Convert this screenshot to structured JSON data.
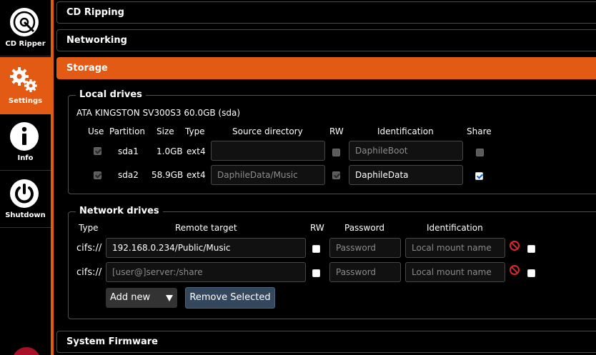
{
  "sidebar": {
    "items": [
      {
        "label": "CD Ripper",
        "icon": "cd-icon"
      },
      {
        "label": "Settings",
        "icon": "gears-icon"
      },
      {
        "label": "Info",
        "icon": "info-icon"
      },
      {
        "label": "Shutdown",
        "icon": "power-icon"
      }
    ]
  },
  "sections": {
    "cd_ripping": "CD Ripping",
    "networking": "Networking",
    "storage": "Storage",
    "system_firmware": "System Firmware"
  },
  "local_drives": {
    "legend": "Local drives",
    "drive_name": "ATA KINGSTON SV300S3 60.0GB (sda)",
    "headers": {
      "use": "Use",
      "partition": "Partition",
      "size": "Size",
      "type": "Type",
      "source": "Source directory",
      "rw": "RW",
      "identification": "Identification",
      "share": "Share"
    },
    "rows": [
      {
        "partition": "sda1",
        "size": "1.0GB",
        "type": "ext4",
        "source": "",
        "identification": "DaphileBoot"
      },
      {
        "partition": "sda2",
        "size": "58.9GB",
        "type": "ext4",
        "source": "DaphileData/Music",
        "identification": "DaphileData"
      }
    ]
  },
  "network_drives": {
    "legend": "Network drives",
    "headers": {
      "type": "Type",
      "remote": "Remote target",
      "rw": "RW",
      "password": "Password",
      "identification": "Identification"
    },
    "rows": [
      {
        "type": "cifs://",
        "remote": "192.168.0.234/Public/Music",
        "password_placeholder": "Password",
        "identification_placeholder": "Local mount name"
      },
      {
        "type": "cifs://",
        "remote_placeholder": "[user@]server:/share",
        "password_placeholder": "Password",
        "identification_placeholder": "Local mount name"
      }
    ],
    "add_new": "Add new",
    "remove_selected": "Remove Selected"
  },
  "colors": {
    "accent": "#e35a14",
    "button": "#34475d",
    "remove_icon": "#d82a2a"
  }
}
